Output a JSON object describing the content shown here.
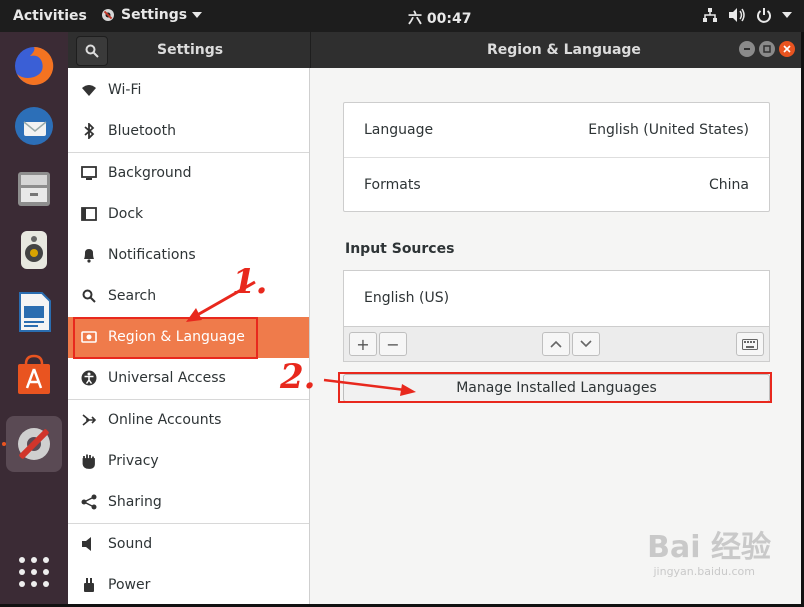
{
  "topbar": {
    "activities": "Activities",
    "app_name": "Settings",
    "clock": "六 00:47"
  },
  "window": {
    "sidebar_title": "Settings",
    "title": "Region & Language"
  },
  "sidebar": {
    "items": [
      {
        "label": "Wi-Fi",
        "icon": "wifi-icon"
      },
      {
        "label": "Bluetooth",
        "icon": "bluetooth-icon"
      },
      {
        "label": "Background",
        "icon": "background-icon"
      },
      {
        "label": "Dock",
        "icon": "dock-icon"
      },
      {
        "label": "Notifications",
        "icon": "bell-icon"
      },
      {
        "label": "Search",
        "icon": "search-icon"
      },
      {
        "label": "Region & Language",
        "icon": "region-icon",
        "selected": true
      },
      {
        "label": "Universal Access",
        "icon": "accessibility-icon"
      },
      {
        "label": "Online Accounts",
        "icon": "online-accounts-icon"
      },
      {
        "label": "Privacy",
        "icon": "hand-icon"
      },
      {
        "label": "Sharing",
        "icon": "share-icon"
      },
      {
        "label": "Sound",
        "icon": "speaker-icon"
      },
      {
        "label": "Power",
        "icon": "power-icon"
      }
    ]
  },
  "region": {
    "language_label": "Language",
    "language_value": "English (United States)",
    "formats_label": "Formats",
    "formats_value": "China",
    "input_sources_title": "Input Sources",
    "input_source_1": "English (US)",
    "add_label": "+",
    "remove_label": "−",
    "manage_button": "Manage Installed Languages"
  },
  "annotations": {
    "marker_1": "1.",
    "marker_2": "2."
  },
  "watermark": {
    "brand": "Bai 经验",
    "url": "jingyan.baidu.com"
  },
  "colors": {
    "accent": "#ef7b4b",
    "annotation": "#e8281d",
    "topbar": "#1d1d1d",
    "dock": "#3b2b35"
  }
}
